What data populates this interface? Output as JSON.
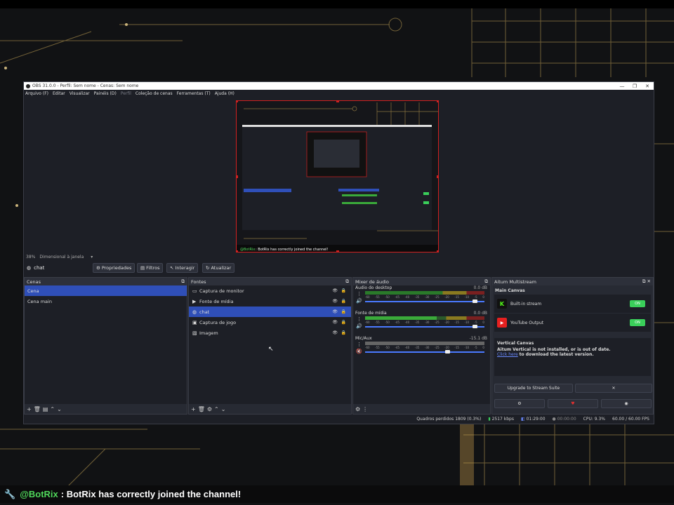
{
  "window": {
    "title": "OBS 31.0.0 - Perfil: Sem nome - Cenas: Sem nome",
    "controls": [
      "—",
      "❐",
      "✕"
    ]
  },
  "menu": [
    "Arquivo (F)",
    "Editar",
    "Visualizar",
    "Painéis (D)",
    "Perfil",
    "Coleção de cenas",
    "Ferramentas (T)",
    "Ajuda (H)"
  ],
  "zoom": {
    "value": "38%",
    "mode": "Dimensional à janela"
  },
  "context": {
    "source_name": "chat",
    "buttons": {
      "properties": "Propriedades",
      "filters": "Filtros",
      "interact": "Interagir",
      "refresh": "Atualizar"
    }
  },
  "scenes": {
    "title": "Cenas",
    "items": [
      {
        "label": "Cena",
        "selected": true
      },
      {
        "label": "Cena main",
        "selected": false
      }
    ]
  },
  "sources": {
    "title": "Fontes",
    "items": [
      {
        "label": "Captura de monitor",
        "icon": "monitor-icon",
        "selected": false
      },
      {
        "label": "Fonte de mídia",
        "icon": "play-icon",
        "selected": false
      },
      {
        "label": "chat",
        "icon": "globe-icon",
        "selected": true
      },
      {
        "label": "Captura de jogo",
        "icon": "gamepad-icon",
        "selected": false
      },
      {
        "label": "Imagem",
        "icon": "image-icon",
        "selected": false
      }
    ]
  },
  "mixer": {
    "title": "Mixer de áudio",
    "scale": [
      "-60",
      "-55",
      "-50",
      "-45",
      "-40",
      "-35",
      "-30",
      "-25",
      "-20",
      "-15",
      "-10",
      "-5",
      "0"
    ],
    "channels": [
      {
        "name": "Áudio do desktop",
        "db": "0.0 dB",
        "level": 0.94
      },
      {
        "name": "Fonte de mídia",
        "db": "0.0 dB",
        "level": 0.94
      },
      {
        "name": "Mic/Aux",
        "db": "-15.1 dB",
        "level": 0.7
      }
    ]
  },
  "multistream": {
    "title": "Aitum Multistream",
    "main_canvas": "Main Canvas",
    "outputs": [
      {
        "name": "Built-in stream",
        "icon_letter": "K",
        "toggle": "ON"
      },
      {
        "name": "YouTube Output",
        "icon_letter": "▶",
        "toggle": "ON"
      }
    ],
    "vertical_canvas": "Vertical Canvas",
    "vertical_warning": "Aitum Vertical is not installed, or is out of date.",
    "click_here": "Click here",
    "download_text": "to download the latest version.",
    "upgrade_btn": "Upgrade to Stream Suite",
    "close_btn": "✕"
  },
  "status": {
    "dropped_frames": "Quadros perdidos 1809 (0.3%)",
    "bitrate": "2517 kbps",
    "rec_time": "01:29:00",
    "stream_time": "00:00:00",
    "cpu": "CPU: 9.3%",
    "fps": "60.00 / 60.00 FPS"
  },
  "chat_overlay": {
    "user": "@BotRix",
    "message": ": BotRix has correctly joined the channel!"
  },
  "colors": {
    "accent": "#2f4fb8",
    "toggle_on": "#3acf5a",
    "selection_border": "#d02020",
    "chat_user": "#4fd75a"
  }
}
